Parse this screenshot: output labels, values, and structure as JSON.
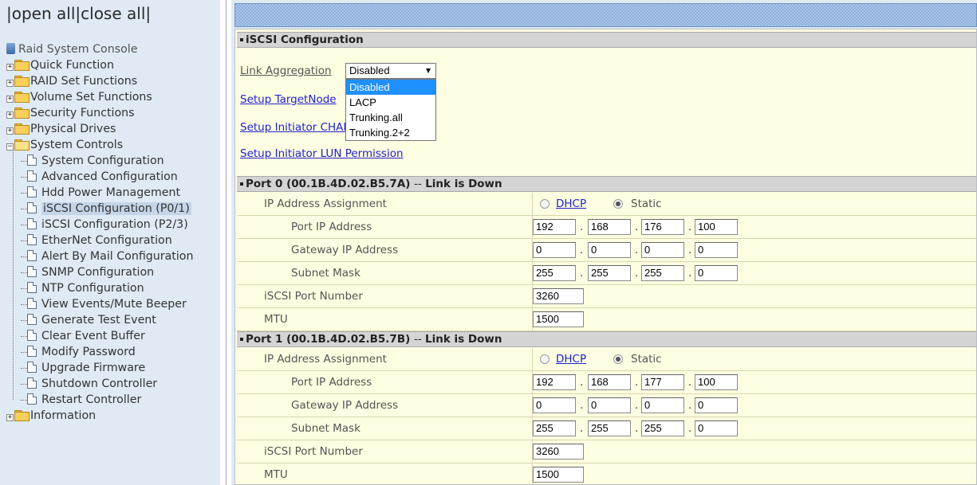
{
  "tree": {
    "open_all": "open all",
    "close_all": "close all",
    "root": "Raid System Console",
    "groups": [
      {
        "label": "Quick Function"
      },
      {
        "label": "RAID Set Functions"
      },
      {
        "label": "Volume Set Functions"
      },
      {
        "label": "Security Functions"
      },
      {
        "label": "Physical Drives"
      },
      {
        "label": "System Controls"
      }
    ],
    "system_controls_items": [
      "System Configuration",
      "Advanced Configuration",
      "Hdd Power Management",
      "iSCSI Configuration (P0/1)",
      "iSCSI Configuration (P2/3)",
      "EtherNet Configuration",
      "Alert By Mail Configuration",
      "SNMP Configuration",
      "NTP Configuration",
      "View Events/Mute Beeper",
      "Generate Test Event",
      "Clear Event Buffer",
      "Modify Password",
      "Upgrade Firmware",
      "Shutdown Controller",
      "Restart Controller"
    ],
    "selected_item": "iSCSI Configuration (P0/1)",
    "last_group": "Information"
  },
  "iscsi": {
    "title": "iSCSI Configuration",
    "link_aggregation_label": "Link Aggregation",
    "link_aggregation_value": "Disabled",
    "link_aggregation_options": [
      "Disabled",
      "LACP",
      "Trunking.all",
      "Trunking.2+2"
    ],
    "setup_target_node": "Setup TargetNode",
    "setup_initiator_chap": "Setup Initiator CHAP",
    "setup_initiator_lun": "Setup Initiator LUN Permission"
  },
  "ports": [
    {
      "header": "Port 0 (00.1B.4D.02.B5.7A)",
      "status_prefix": "--",
      "status_text": "Link is Down",
      "ip_assignment_label": "IP Address Assignment",
      "dhcp_label": "DHCP",
      "static_label": "Static",
      "mode": "Static",
      "port_ip_label": "Port IP Address",
      "port_ip": [
        "192",
        "168",
        "176",
        "100"
      ],
      "gateway_label": "Gateway IP Address",
      "gateway_ip": [
        "0",
        "0",
        "0",
        "0"
      ],
      "subnet_label": "Subnet Mask",
      "subnet": [
        "255",
        "255",
        "255",
        "0"
      ],
      "iscsi_port_label": "iSCSI Port Number",
      "iscsi_port": "3260",
      "mtu_label": "MTU",
      "mtu": "1500"
    },
    {
      "header": "Port 1 (00.1B.4D.02.B5.7B)",
      "status_prefix": "--",
      "status_text": "Link is Down",
      "ip_assignment_label": "IP Address Assignment",
      "dhcp_label": "DHCP",
      "static_label": "Static",
      "mode": "Static",
      "port_ip_label": "Port IP Address",
      "port_ip": [
        "192",
        "168",
        "177",
        "100"
      ],
      "gateway_label": "Gateway IP Address",
      "gateway_ip": [
        "0",
        "0",
        "0",
        "0"
      ],
      "subnet_label": "Subnet Mask",
      "subnet": [
        "255",
        "255",
        "255",
        "0"
      ],
      "iscsi_port_label": "iSCSI Port Number",
      "iscsi_port": "3260",
      "mtu_label": "MTU",
      "mtu": "1500"
    }
  ],
  "colors": {
    "panel_bg": "#dfeaf4",
    "content_bg": "#fdfde1",
    "section_header_bg": "#d4d4d4",
    "link": "#2222cc",
    "option_highlight": "#1e90ff"
  }
}
